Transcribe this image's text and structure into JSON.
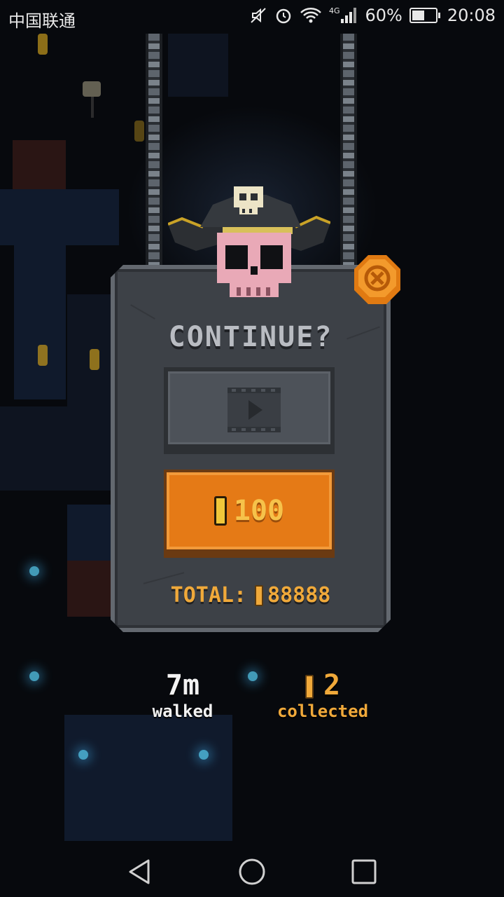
{
  "status_bar": {
    "carrier": "中国联通",
    "network": "4G",
    "battery_percent": "60%",
    "battery_level": 0.6,
    "time": "20:08",
    "icons": [
      "mute-icon",
      "alarm-icon",
      "wifi-icon",
      "signal-icon",
      "battery-icon"
    ]
  },
  "dialog": {
    "title": "CONTINUE?",
    "video_button_icon": "film-play-icon",
    "coin_button_price": "100",
    "total_label": "TOTAL:",
    "total_value": "88888",
    "close_icon": "close-x-icon"
  },
  "stats": {
    "walked_value": "7m",
    "walked_label": "walked",
    "collected_value": "2",
    "collected_label": "collected"
  },
  "nav_bar": {
    "icons": [
      "back-icon",
      "home-icon",
      "recents-icon"
    ]
  },
  "colors": {
    "accent_orange": "#e57a16",
    "coin_gold": "#f0a93a",
    "panel_gray": "#3d4147"
  }
}
